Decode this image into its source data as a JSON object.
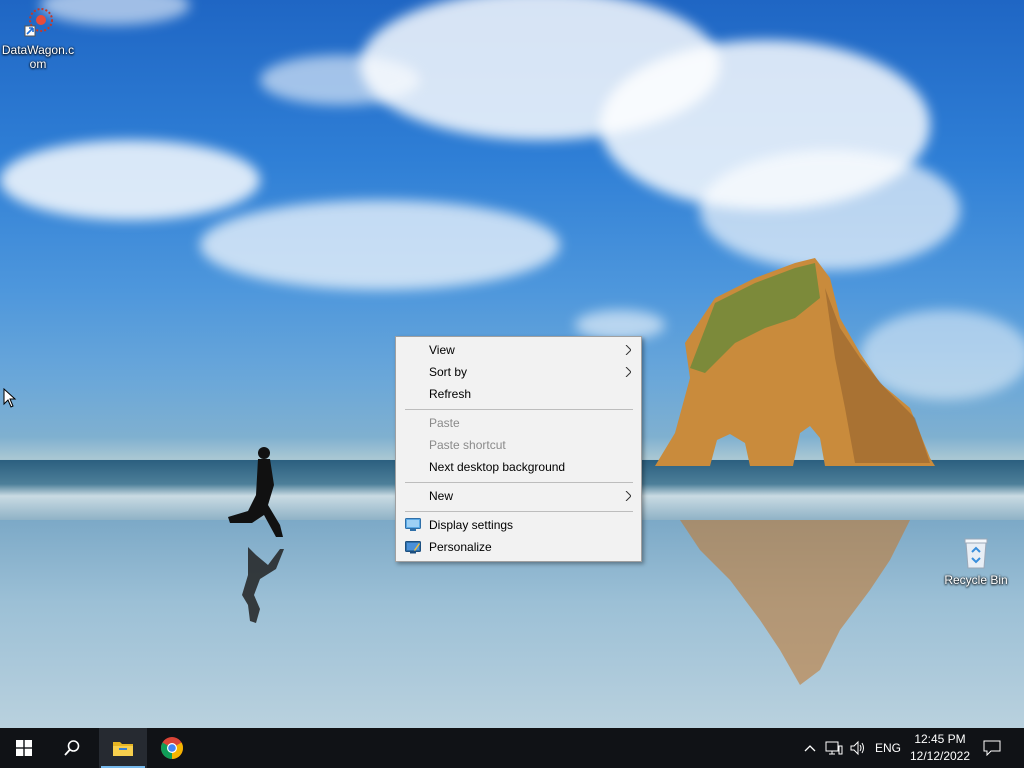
{
  "desktop": {
    "icons": [
      {
        "label": "DataWagon.c om",
        "icon": "datawagon-shortcut-icon"
      },
      {
        "label": "Recycle Bin",
        "icon": "recycle-bin-icon"
      }
    ]
  },
  "context_menu": {
    "items": [
      {
        "label": "View",
        "submenu": true,
        "enabled": true
      },
      {
        "label": "Sort by",
        "submenu": true,
        "enabled": true
      },
      {
        "label": "Refresh",
        "submenu": false,
        "enabled": true
      },
      {
        "label": "Paste",
        "submenu": false,
        "enabled": false
      },
      {
        "label": "Paste shortcut",
        "submenu": false,
        "enabled": false
      },
      {
        "label": "Next desktop background",
        "submenu": false,
        "enabled": true
      },
      {
        "label": "New",
        "submenu": true,
        "enabled": true
      },
      {
        "label": "Display settings",
        "submenu": false,
        "enabled": true,
        "icon": "display-settings-icon"
      },
      {
        "label": "Personalize",
        "submenu": false,
        "enabled": true,
        "icon": "personalize-icon"
      }
    ]
  },
  "taskbar": {
    "start": "windows-logo-icon",
    "search": "search-icon",
    "pinned": [
      "file-explorer-icon",
      "chrome-icon"
    ],
    "tray": {
      "language": "ENG",
      "time": "12:45 PM",
      "date": "12/12/2022"
    }
  },
  "colors": {
    "taskbar_bg": "#101216",
    "menu_bg": "#f2f2f2",
    "active_indicator": "#76b9ed"
  }
}
